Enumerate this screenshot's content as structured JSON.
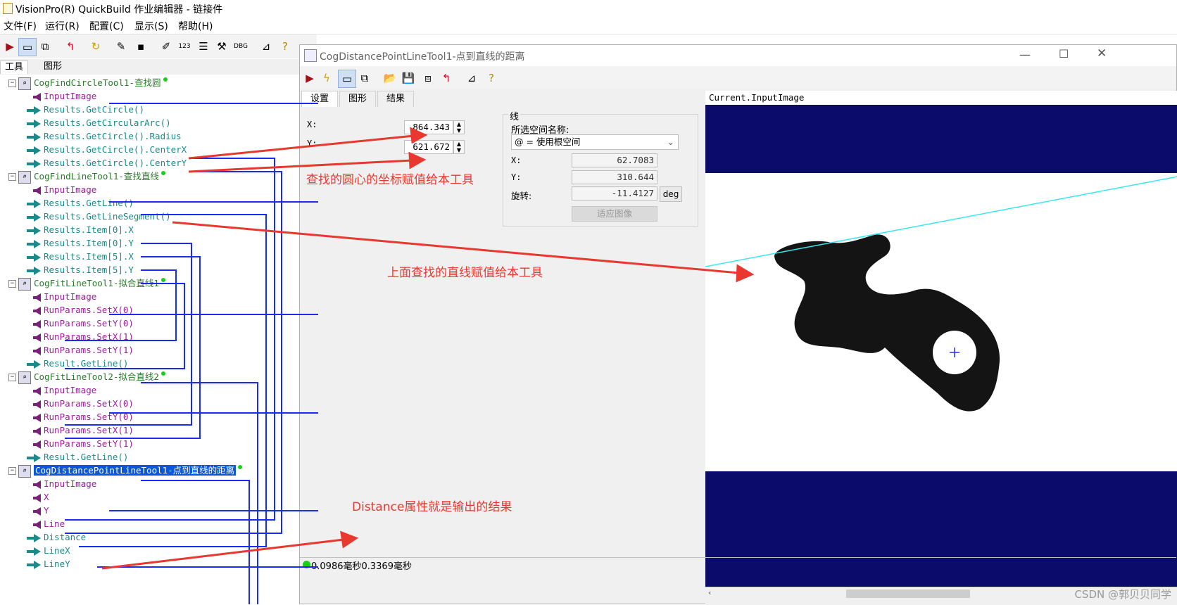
{
  "window": {
    "title": "VisionPro(R) QuickBuild 作业编辑器 - 链接件"
  },
  "menu": [
    "文件(F)",
    "运行(R)",
    "配置(C)",
    "显示(S)",
    "帮助(H)"
  ],
  "left_tabs": [
    "工具",
    "图形"
  ],
  "tree": [
    {
      "kind": "tool",
      "label": "CogFindCircleTool1-查找圆",
      "expander": "−"
    },
    {
      "kind": "in",
      "label": "InputImage"
    },
    {
      "kind": "out",
      "label": "Results.GetCircle()"
    },
    {
      "kind": "out",
      "label": "Results.GetCircularArc()"
    },
    {
      "kind": "out",
      "label": "Results.GetCircle().Radius"
    },
    {
      "kind": "out",
      "label": "Results.GetCircle().CenterX"
    },
    {
      "kind": "out",
      "label": "Results.GetCircle().CenterY"
    },
    {
      "kind": "tool",
      "label": "CogFindLineTool1-查找直线",
      "expander": "−"
    },
    {
      "kind": "in",
      "label": "InputImage"
    },
    {
      "kind": "out",
      "label": "Results.GetLine()"
    },
    {
      "kind": "out",
      "label": "Results.GetLineSegment()"
    },
    {
      "kind": "out",
      "label": "Results.Item[0].X"
    },
    {
      "kind": "out",
      "label": "Results.Item[0].Y"
    },
    {
      "kind": "out",
      "label": "Results.Item[5].X"
    },
    {
      "kind": "out",
      "label": "Results.Item[5].Y"
    },
    {
      "kind": "tool",
      "label": "CogFitLineTool1-拟合直线1",
      "expander": "−"
    },
    {
      "kind": "in",
      "label": "InputImage"
    },
    {
      "kind": "in",
      "label": "RunParams.SetX(0)"
    },
    {
      "kind": "in",
      "label": "RunParams.SetY(0)"
    },
    {
      "kind": "in",
      "label": "RunParams.SetX(1)"
    },
    {
      "kind": "in",
      "label": "RunParams.SetY(1)"
    },
    {
      "kind": "out",
      "label": "Result.GetLine()"
    },
    {
      "kind": "tool",
      "label": "CogFitLineTool2-拟合直线2",
      "expander": "−"
    },
    {
      "kind": "in",
      "label": "InputImage"
    },
    {
      "kind": "in",
      "label": "RunParams.SetX(0)"
    },
    {
      "kind": "in",
      "label": "RunParams.SetY(0)"
    },
    {
      "kind": "in",
      "label": "RunParams.SetX(1)"
    },
    {
      "kind": "in",
      "label": "RunParams.SetY(1)"
    },
    {
      "kind": "out",
      "label": "Result.GetLine()"
    },
    {
      "kind": "tool",
      "label": "CogDistancePointLineTool1-点到直线的距离",
      "expander": "−",
      "selected": true
    },
    {
      "kind": "in",
      "label": "InputImage"
    },
    {
      "kind": "in",
      "label": "X"
    },
    {
      "kind": "in",
      "label": "Y"
    },
    {
      "kind": "in",
      "label": "Line"
    },
    {
      "kind": "out",
      "label": "Distance"
    },
    {
      "kind": "out",
      "label": "LineX"
    },
    {
      "kind": "out",
      "label": "LineY"
    }
  ],
  "child": {
    "title": "CogDistancePointLineTool1-点到直线的距离",
    "tabs": [
      "设置",
      "图形",
      "结果"
    ],
    "x_label": "X:",
    "x_value": "864.343",
    "y_label": "Y:",
    "y_value": "621.672",
    "group_title": "线",
    "space_label": "所选空间名称:",
    "space_value": "@ = 使用根空间",
    "lx_label": "X:",
    "lx_value": "62.7083",
    "ly_label": "Y:",
    "ly_value": "310.644",
    "rot_label": "旋转:",
    "rot_value": "-11.4127",
    "deg_button": "deg",
    "fit_button": "适应图像",
    "image_title": "Current.InputImage",
    "status": "0.0986毫秒0.3369毫秒"
  },
  "annotations": {
    "circle_center": "查找的圆心的坐标赋值给本工具",
    "line": "上面查找的直线赋值给本工具",
    "distance": "Distance属性就是输出的结果"
  },
  "watermark": "CSDN @郭贝贝同学",
  "colors": {
    "link_blue": "#1a2cf0",
    "annot_red": "#e8382f",
    "image_navy": "#0b0b6b",
    "line_cyan": "#38e8f0",
    "selection": "#0a58d8"
  }
}
